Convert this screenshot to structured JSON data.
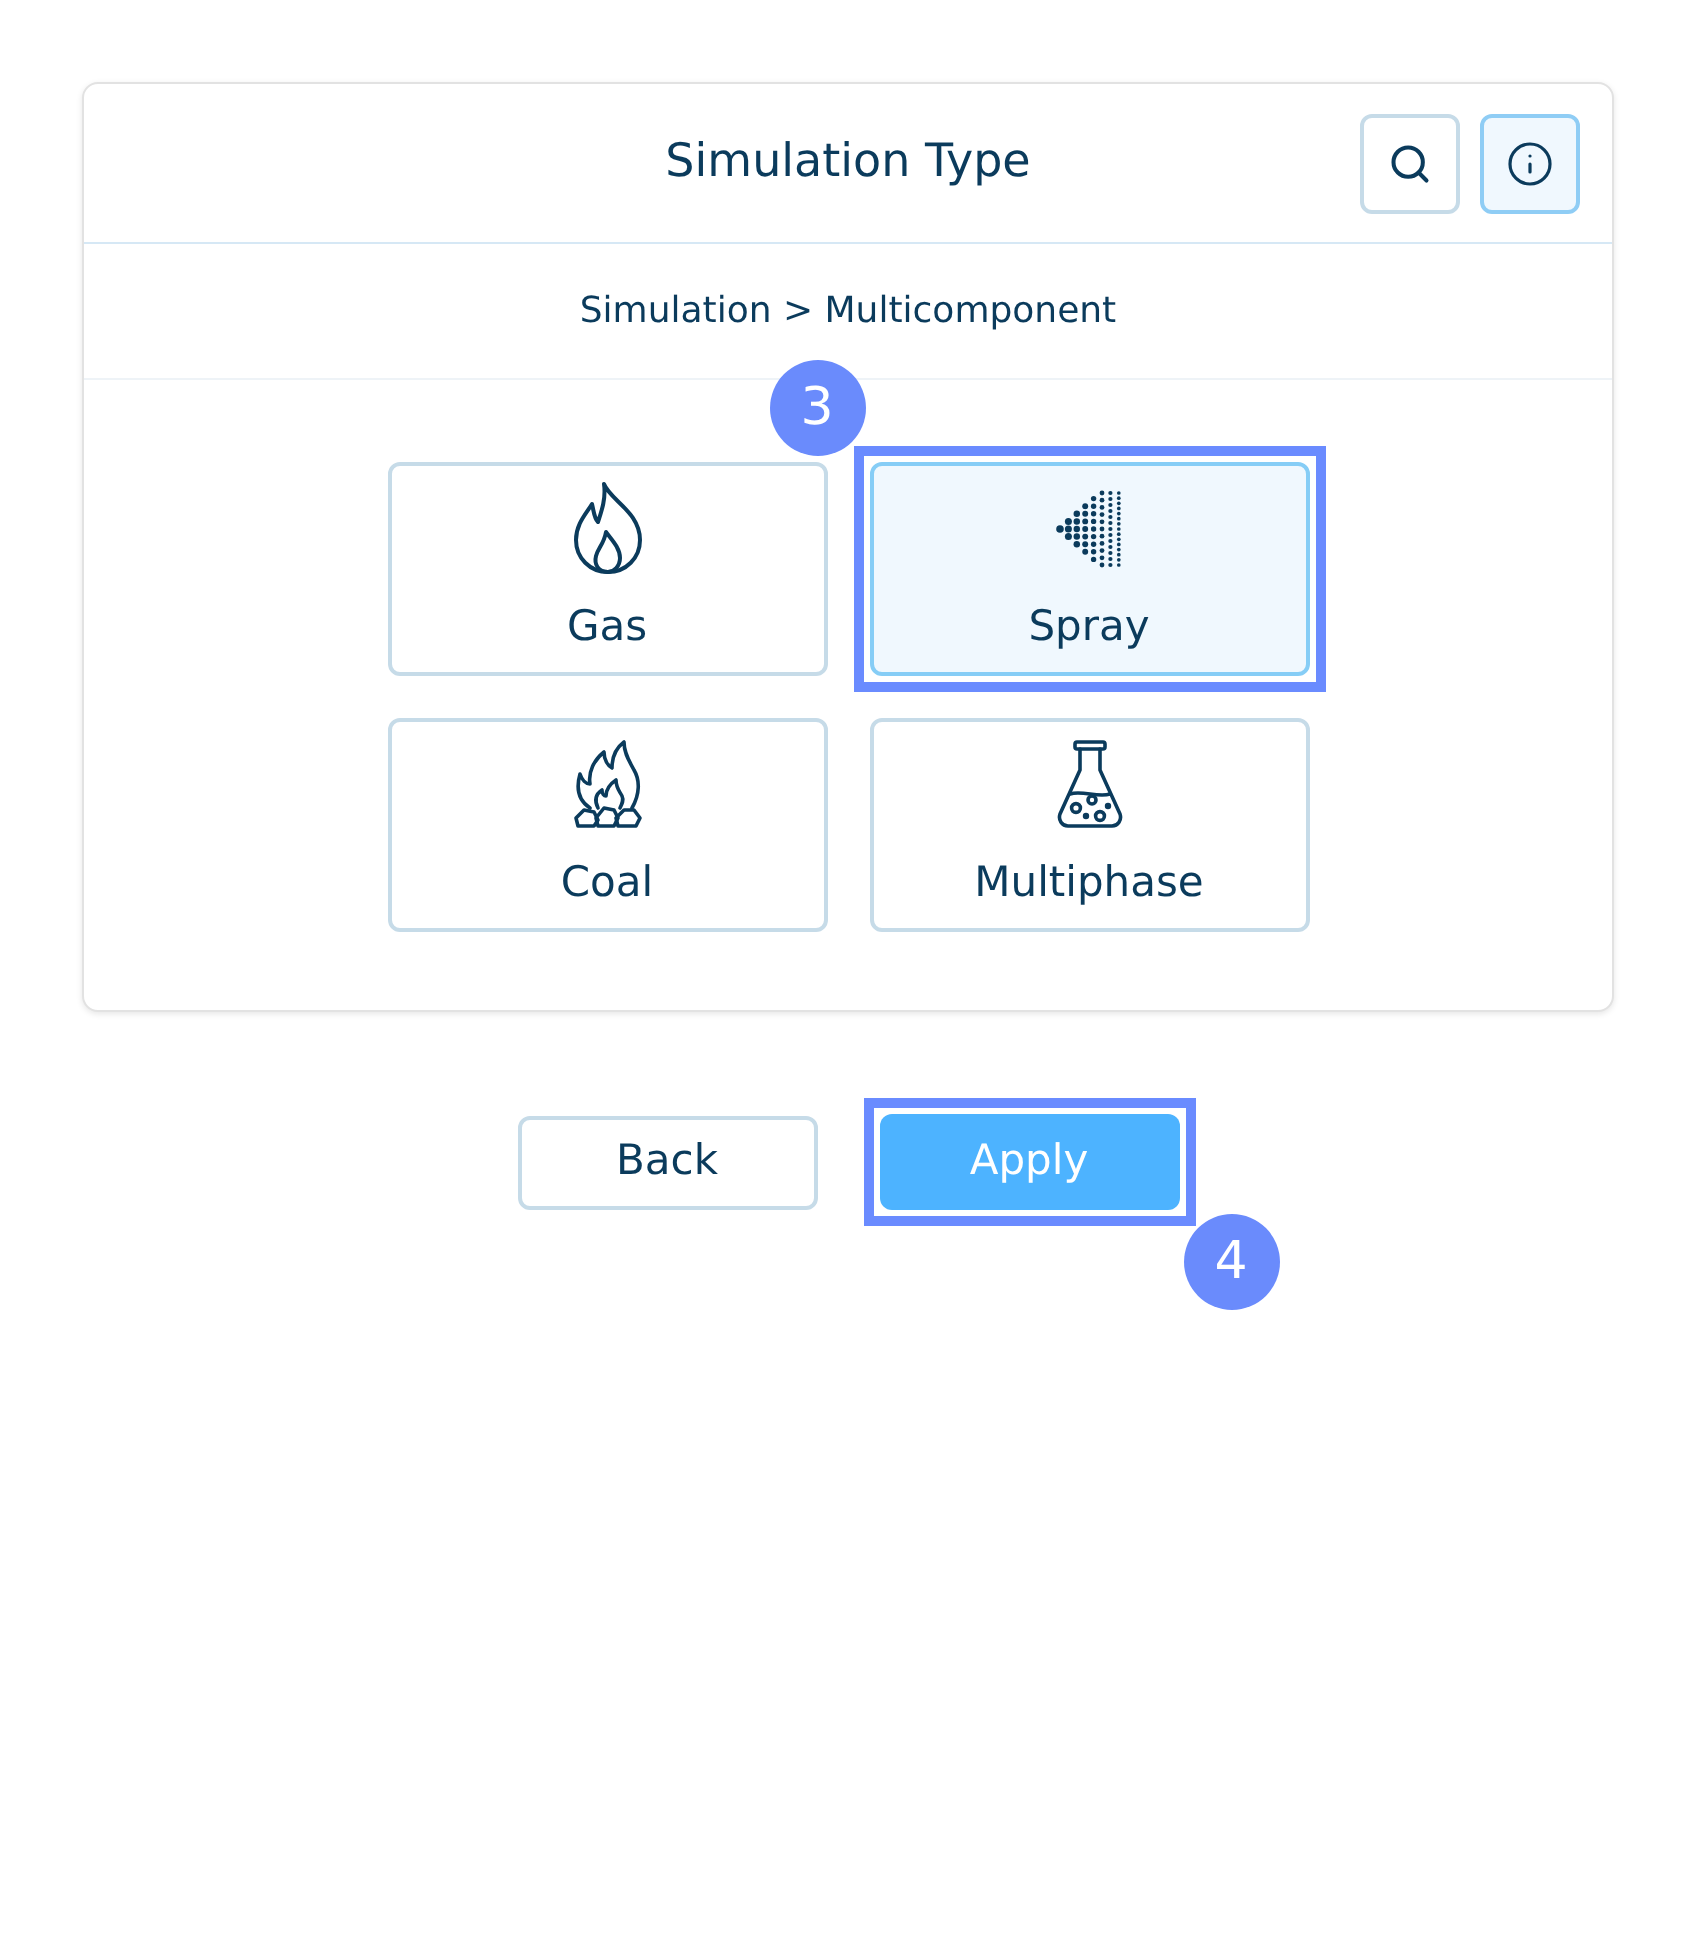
{
  "header": {
    "title": "Simulation Type",
    "buttons": [
      {
        "kind": "search",
        "active": false
      },
      {
        "kind": "info",
        "active": true
      }
    ]
  },
  "breadcrumb": "Simulation > Multicomponent",
  "options": [
    {
      "kind": "gas",
      "label": "Gas",
      "selected": false,
      "highlighted": false
    },
    {
      "kind": "spray",
      "label": "Spray",
      "selected": true,
      "highlighted": true,
      "tutorial_step": "3"
    },
    {
      "kind": "coal",
      "label": "Coal",
      "selected": false,
      "highlighted": false
    },
    {
      "kind": "multiphase",
      "label": "Multiphase",
      "selected": false,
      "highlighted": false
    }
  ],
  "actions": [
    {
      "kind": "secondary",
      "label": "Back",
      "highlighted": false
    },
    {
      "kind": "primary",
      "label": "Apply",
      "highlighted": true,
      "tutorial_step": "4"
    }
  ]
}
